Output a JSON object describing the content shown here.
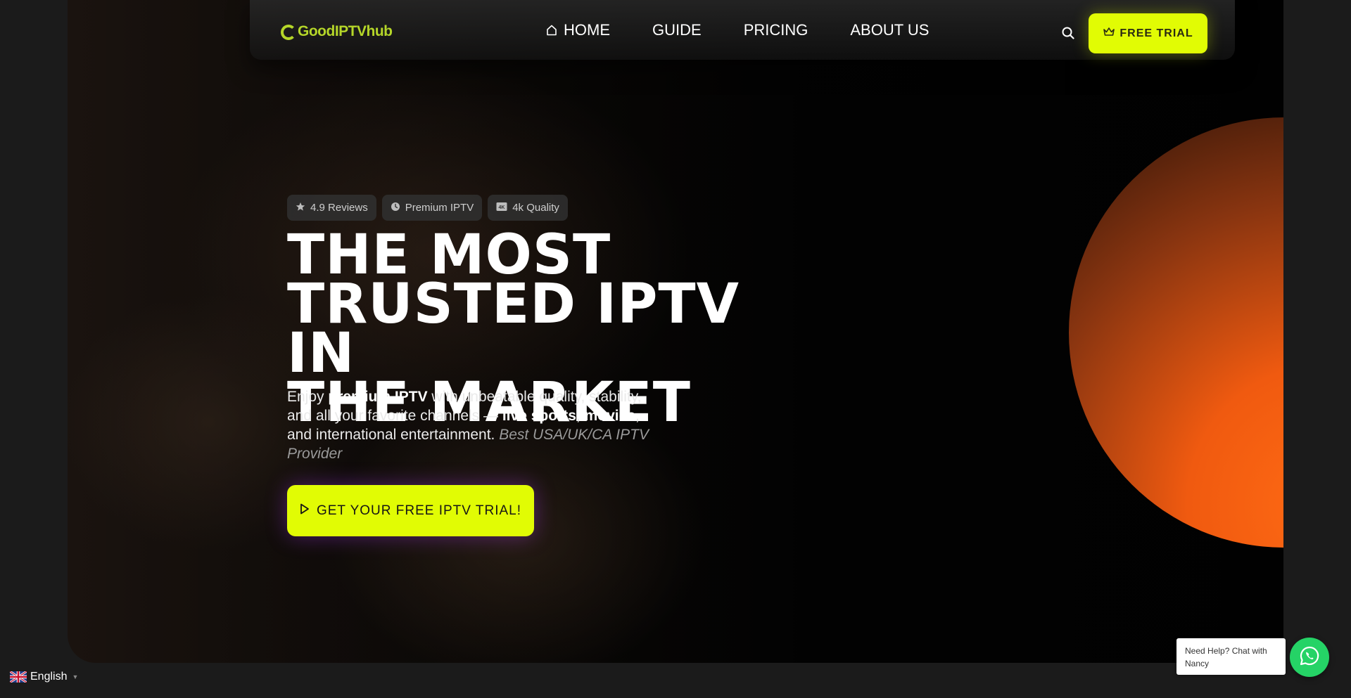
{
  "nav": {
    "logo": "GoodIPTVhub",
    "links": [
      "HOME",
      "GUIDE",
      "PRICING",
      "ABOUT US"
    ],
    "trial_label": "FREE TRIAL"
  },
  "badges": [
    {
      "icon": "star-icon",
      "label": "4.9 Reviews"
    },
    {
      "icon": "clock-icon",
      "label": "Premium IPTV"
    },
    {
      "icon": "4k-icon",
      "label": "4k Quality"
    }
  ],
  "hero": {
    "headline_lines": [
      "THE MOST",
      "TRUSTED IPTV IN",
      "THE MARKET"
    ],
    "desc": {
      "p1": "Enjoy ",
      "b1": "premium IPTV",
      "p2": " with unbeatable quality, stability, and all your favorite channels — ",
      "b2": "live sports",
      "p3": ", ",
      "b3": "movies",
      "p4": ", and international entertainment. ",
      "muted": "Best USA/UK/CA IPTV Provider"
    },
    "cta_label": "GET YOUR FREE IPTV TRIAL!"
  },
  "footer": {
    "language": "English",
    "help_text": "Need Help? Chat with Nancy"
  },
  "colors": {
    "accent": "#e1fc04",
    "logo": "#b5d629",
    "orb": "#ff6a13",
    "whatsapp": "#25d366"
  }
}
